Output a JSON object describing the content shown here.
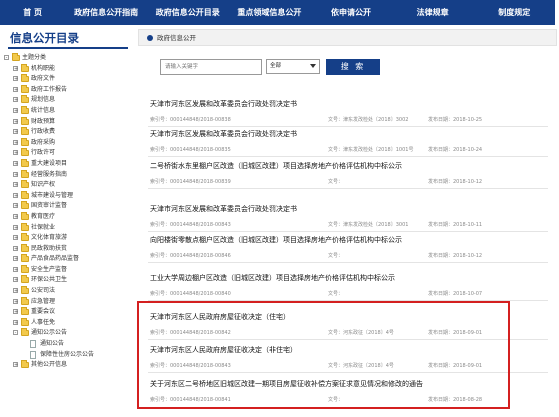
{
  "topnav": {
    "items": [
      "首  页",
      "政府信息公开指南",
      "政府信息公开目录",
      "重点领域信息公开",
      "依申请公开",
      "法律规章",
      "制度规定"
    ]
  },
  "sidebar": {
    "title": "信息公开目录",
    "tree": [
      {
        "label": "主题分类",
        "level": 0,
        "toggle": "-",
        "icon": "folder"
      },
      {
        "label": "机构职能",
        "level": 1,
        "toggle": "+",
        "icon": "folder"
      },
      {
        "label": "政府文件",
        "level": 1,
        "toggle": "+",
        "icon": "folder"
      },
      {
        "label": "政府工作报告",
        "level": 1,
        "toggle": "+",
        "icon": "folder"
      },
      {
        "label": "规划信息",
        "level": 1,
        "toggle": "+",
        "icon": "folder"
      },
      {
        "label": "统计信息",
        "level": 1,
        "toggle": "+",
        "icon": "folder"
      },
      {
        "label": "财政预算",
        "level": 1,
        "toggle": "+",
        "icon": "folder"
      },
      {
        "label": "行政收费",
        "level": 1,
        "toggle": "+",
        "icon": "folder"
      },
      {
        "label": "政府采购",
        "level": 1,
        "toggle": "+",
        "icon": "folder"
      },
      {
        "label": "行政许可",
        "level": 1,
        "toggle": "+",
        "icon": "folder"
      },
      {
        "label": "重大建设项目",
        "level": 1,
        "toggle": "+",
        "icon": "folder"
      },
      {
        "label": "经营服务指南",
        "level": 1,
        "toggle": "+",
        "icon": "folder"
      },
      {
        "label": "知识产权",
        "level": 1,
        "toggle": "+",
        "icon": "folder"
      },
      {
        "label": "城市建设与管理",
        "level": 1,
        "toggle": "+",
        "icon": "folder"
      },
      {
        "label": "国资审计监督",
        "level": 1,
        "toggle": "+",
        "icon": "folder"
      },
      {
        "label": "教育医疗",
        "level": 1,
        "toggle": "+",
        "icon": "folder"
      },
      {
        "label": "社保就业",
        "level": 1,
        "toggle": "+",
        "icon": "folder"
      },
      {
        "label": "文化体育旅游",
        "level": 1,
        "toggle": "+",
        "icon": "folder"
      },
      {
        "label": "民政救助扶贫",
        "level": 1,
        "toggle": "+",
        "icon": "folder"
      },
      {
        "label": "产品食品药品监督",
        "level": 1,
        "toggle": "+",
        "icon": "folder"
      },
      {
        "label": "安全生产监督",
        "level": 1,
        "toggle": "+",
        "icon": "folder"
      },
      {
        "label": "环保公共卫生",
        "level": 1,
        "toggle": "+",
        "icon": "folder"
      },
      {
        "label": "公安司法",
        "level": 1,
        "toggle": "+",
        "icon": "folder"
      },
      {
        "label": "应急管理",
        "level": 1,
        "toggle": "+",
        "icon": "folder"
      },
      {
        "label": "重要会议",
        "level": 1,
        "toggle": "+",
        "icon": "folder"
      },
      {
        "label": "人事任免",
        "level": 1,
        "toggle": "+",
        "icon": "folder"
      },
      {
        "label": "通知公示公告",
        "level": 1,
        "toggle": "-",
        "icon": "folder"
      },
      {
        "label": "通知公告",
        "level": 2,
        "toggle": "",
        "icon": "doc"
      },
      {
        "label": "保障性住房公示公告",
        "level": 2,
        "toggle": "",
        "icon": "doc"
      },
      {
        "label": "其他公开信息",
        "level": 1,
        "toggle": "+",
        "icon": "folder"
      }
    ]
  },
  "main": {
    "panel_title": "政府信息公开",
    "search": {
      "placeholder": "请输入关键字",
      "select_value": "全部",
      "button_label": "搜  索"
    },
    "articles": [
      {
        "title": "天津市河东区发展和改革委员会行政处罚决定书",
        "index": "索引号：000144848/2018-00838",
        "doc_no": "文号：津东发改检处〔2018〕3002",
        "date": "发布日期：2018-10-25"
      },
      {
        "title": "天津市河东区发展和改革委员会行政处罚决定书",
        "index": "索引号：000144848/2018-00835",
        "doc_no": "文号：津东发改检处〔2018〕1001号",
        "date": "发布日期：2018-10-24"
      },
      {
        "title": "二号桥街水东里棚户区改造（旧城区改建）项目选择房地产价格评估机构中标公示",
        "index": "索引号：000144848/2018-00839",
        "doc_no": "文号：",
        "date": "发布日期：2018-10-12"
      },
      {
        "title": "天津市河东区发展和改革委员会行政处罚决定书",
        "index": "索引号：000144848/2018-00843",
        "doc_no": "文号：津东发改检处〔2018〕3001",
        "date": "发布日期：2018-10-11"
      },
      {
        "title": "向阳楼街零散点棚户区改造（旧城区改建）项目选择房地产价格评估机构中标公示",
        "index": "索引号：000144848/2018-00846",
        "doc_no": "文号：",
        "date": "发布日期：2018-10-12"
      },
      {
        "title": "工业大学周边棚户区改造（旧城区改建）项目选择房地产价格评估机构中标公示",
        "index": "索引号：000144848/2018-00840",
        "doc_no": "文号：",
        "date": "发布日期：2018-10-07"
      },
      {
        "title": "天津市河东区人民政府房屋征收决定（住宅）",
        "index": "索引号：000144848/2018-00842",
        "doc_no": "文号：河东政征〔2018〕4号",
        "date": "发布日期：2018-09-01"
      },
      {
        "title": "天津市河东区人民政府房屋征收决定（非住宅）",
        "index": "索引号：000144848/2018-00843",
        "doc_no": "文号：河东政征〔2018〕4号",
        "date": "发布日期：2018-09-01"
      },
      {
        "title": "关于河东区二号桥地区旧城区改建一期项目房屋征收补偿方案征求意见情况和修改的通告",
        "index": "索引号：000144848/2018-00841",
        "doc_no": "文号：",
        "date": "发布日期：2018-08-28"
      }
    ]
  }
}
